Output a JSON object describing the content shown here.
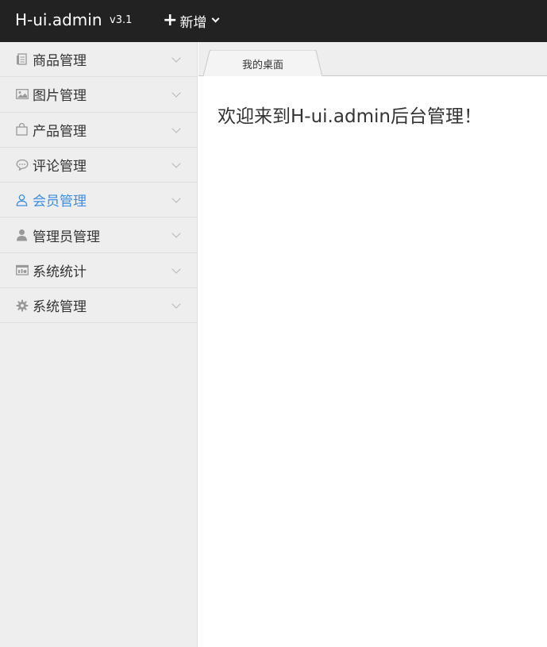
{
  "header": {
    "logo": "H-ui.admin",
    "version": "v3.1",
    "add_label": "新增"
  },
  "sidebar": {
    "items": [
      {
        "label": "商品管理",
        "icon": "product-list-icon"
      },
      {
        "label": "图片管理",
        "icon": "image-icon"
      },
      {
        "label": "产品管理",
        "icon": "bag-icon"
      },
      {
        "label": "评论管理",
        "icon": "comment-icon"
      },
      {
        "label": "会员管理",
        "icon": "user-outline-icon",
        "active": true
      },
      {
        "label": "管理员管理",
        "icon": "admin-user-icon"
      },
      {
        "label": "系统统计",
        "icon": "statistics-icon"
      },
      {
        "label": "系统管理",
        "icon": "gear-icon"
      }
    ]
  },
  "tabs": [
    {
      "label": "我的桌面"
    }
  ],
  "main": {
    "welcome": "欢迎来到H-ui.admin后台管理！"
  },
  "colors": {
    "topbar": "#222222",
    "sidebar": "#eeeeee",
    "active": "#3a8ee6"
  }
}
